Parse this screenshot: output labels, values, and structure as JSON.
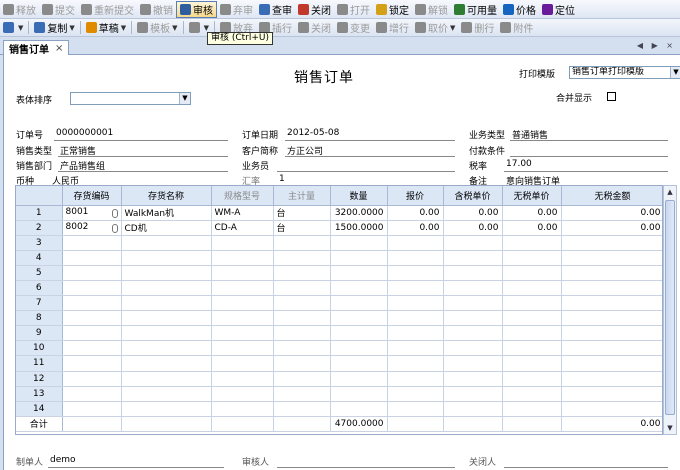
{
  "toolbar1": [
    {
      "label": "释放",
      "icon": "release-icon",
      "enabled": false,
      "color": "#8a8a8a"
    },
    {
      "label": "提交",
      "icon": "submit-icon",
      "enabled": false,
      "color": "#8a8a8a"
    },
    {
      "label": "重新提交",
      "icon": "resubmit-icon",
      "enabled": false,
      "color": "#8a8a8a"
    },
    {
      "label": "撤销",
      "icon": "undo-icon",
      "enabled": false,
      "color": "#8a8a8a"
    },
    {
      "label": "审核",
      "icon": "audit-icon",
      "enabled": true,
      "selected": true,
      "color": "#2f5d9e"
    },
    {
      "label": "弃审",
      "icon": "unaudit-icon",
      "enabled": false,
      "color": "#8a8a8a"
    },
    {
      "label": "查审",
      "icon": "check-audit-icon",
      "enabled": true,
      "color": "#3a6cb5"
    },
    {
      "label": "关闭",
      "icon": "close-doc-icon",
      "enabled": true,
      "color": "#c0392b"
    },
    {
      "label": "打开",
      "icon": "open-doc-icon",
      "enabled": false,
      "color": "#8a8a8a"
    },
    {
      "label": "锁定",
      "icon": "lock-icon",
      "enabled": true,
      "color": "#d4a017"
    },
    {
      "label": "解锁",
      "icon": "unlock-icon",
      "enabled": false,
      "color": "#8a8a8a"
    },
    {
      "label": "可用量",
      "icon": "available-qty-icon",
      "enabled": true,
      "color": "#2e7d32"
    },
    {
      "label": "价格",
      "icon": "price-icon",
      "enabled": true,
      "color": "#1565c0"
    },
    {
      "label": "定位",
      "icon": "locate-icon",
      "enabled": true,
      "color": "#6a1b9a"
    }
  ],
  "toolbar2": [
    {
      "label": "",
      "icon": "new-doc-icon",
      "enabled": true,
      "dropdown": true,
      "color": "#3a6cb5"
    },
    {
      "label": "复制",
      "icon": "copy-icon",
      "enabled": true,
      "dropdown": true,
      "color": "#3a6cb5"
    },
    {
      "label": "草稿",
      "icon": "draft-icon",
      "enabled": true,
      "dropdown": true,
      "color": "#e08a00"
    },
    {
      "label": "模板",
      "icon": "template-icon",
      "enabled": false,
      "dropdown": true,
      "color": "#8a8a8a"
    },
    {
      "label": "",
      "icon": "save-icon",
      "enabled": false,
      "dropdown": true,
      "color": "#8a8a8a"
    },
    {
      "label": "放弃",
      "icon": "discard-icon",
      "enabled": false,
      "color": "#8a8a8a"
    },
    {
      "label": "插行",
      "icon": "insert-row-icon",
      "enabled": false,
      "color": "#8a8a8a"
    },
    {
      "label": "关闭",
      "icon": "close-row-icon",
      "enabled": false,
      "color": "#8a8a8a"
    },
    {
      "label": "变更",
      "icon": "change-icon",
      "enabled": false,
      "color": "#8a8a8a"
    },
    {
      "label": "增行",
      "icon": "add-row-icon",
      "enabled": false,
      "color": "#8a8a8a"
    },
    {
      "label": "取价",
      "icon": "get-price-icon",
      "enabled": false,
      "dropdown": true,
      "color": "#8a8a8a"
    },
    {
      "label": "删行",
      "icon": "delete-row-icon",
      "enabled": false,
      "color": "#8a8a8a"
    },
    {
      "label": "附件",
      "icon": "attachment-icon",
      "enabled": false,
      "color": "#8a8a8a"
    }
  ],
  "tooltip": "审核 (Ctrl+U)",
  "tab": {
    "label": "销售订单",
    "close": "×",
    "nav": "◀ ▶ ×"
  },
  "header": {
    "title": "销售订单",
    "print_template_label": "打印模版",
    "print_template_value": "销售订单打印模版",
    "sort_label": "表体排序",
    "sort_value": "",
    "merge_label": "合并显示"
  },
  "fields": {
    "order_no_label": "订单号",
    "order_no": "0000000001",
    "order_date_label": "订单日期",
    "order_date": "2012-05-08",
    "biz_type_label": "业务类型",
    "biz_type": "普通销售",
    "sales_type_label": "销售类型",
    "sales_type": "正常销售",
    "customer_label": "客户简称",
    "customer": "方正公司",
    "payment_label": "付款条件",
    "payment": "",
    "dept_label": "销售部门",
    "dept": "产品销售组",
    "salesman_label": "业务员",
    "salesman": "",
    "tax_rate_label": "税率",
    "tax_rate": "17.00",
    "currency_label": "币种",
    "currency": "人民币",
    "exchange_label": "汇率",
    "exchange": "1",
    "remark_label": "备注",
    "remark": "意向销售订单"
  },
  "grid": {
    "columns": [
      "",
      "存货编码",
      "存货名称",
      "规格型号",
      "主计量",
      "数量",
      "报价",
      "含税单价",
      "无税单价",
      "无税金额"
    ],
    "rows": [
      {
        "n": "1",
        "code": "8001",
        "name": "WalkMan机",
        "spec": "WM-A",
        "unit": "台",
        "qty": "3200.0000",
        "quote": "0.00",
        "tax_price": "0.00",
        "notax_price": "0.00",
        "amount": "0.00"
      },
      {
        "n": "2",
        "code": "8002",
        "name": "CD机",
        "spec": "CD-A",
        "unit": "台",
        "qty": "1500.0000",
        "quote": "0.00",
        "tax_price": "0.00",
        "notax_price": "0.00",
        "amount": "0.00"
      },
      {
        "n": "3"
      },
      {
        "n": "4"
      },
      {
        "n": "5"
      },
      {
        "n": "6"
      },
      {
        "n": "7"
      },
      {
        "n": "8"
      },
      {
        "n": "9"
      },
      {
        "n": "10"
      },
      {
        "n": "11"
      },
      {
        "n": "12"
      },
      {
        "n": "13"
      },
      {
        "n": "14"
      }
    ],
    "total": {
      "label": "合计",
      "qty": "4700.0000",
      "amount": "0.00"
    }
  },
  "footer": {
    "maker_label": "制单人",
    "maker": "demo",
    "auditor_label": "审核人",
    "auditor": "",
    "closer_label": "关闭人",
    "closer": ""
  }
}
